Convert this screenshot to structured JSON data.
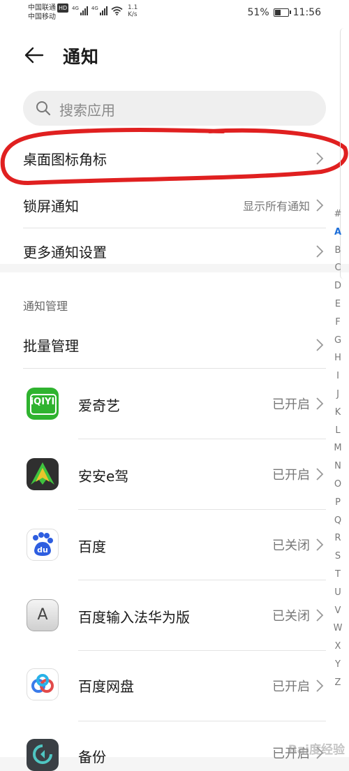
{
  "status_bar": {
    "carrier1": "中国联通",
    "carrier1_badge": "HD",
    "carrier2": "中国移动",
    "net1": "4G",
    "net2": "4G",
    "speed_value": "1.1",
    "speed_unit": "K/s",
    "battery": "51%",
    "battery_level": 0.51,
    "time": "11:56"
  },
  "header": {
    "title": "通知"
  },
  "search": {
    "placeholder": "搜索应用"
  },
  "settings": [
    {
      "label": "桌面图标角标",
      "value": ""
    },
    {
      "label": "锁屏通知",
      "value": "显示所有通知"
    },
    {
      "label": "更多通知设置",
      "value": ""
    }
  ],
  "section": {
    "title": "通知管理",
    "batch_label": "批量管理"
  },
  "apps": [
    {
      "name": "爱奇艺",
      "status": "已开启",
      "icon": "iqiyi-icon",
      "icon_text": "iQIYI"
    },
    {
      "name": "安安e驾",
      "status": "已开启",
      "icon": "anan-edrive-icon",
      "icon_text": ""
    },
    {
      "name": "百度",
      "status": "已关闭",
      "icon": "baidu-icon",
      "icon_text": "du"
    },
    {
      "name": "百度输入法华为版",
      "status": "已关闭",
      "icon": "baidu-input-icon",
      "icon_text": "A"
    },
    {
      "name": "百度网盘",
      "status": "已开启",
      "icon": "baidu-netdisk-icon",
      "icon_text": ""
    },
    {
      "name": "备份",
      "status": "已开启",
      "icon": "backup-icon",
      "icon_text": ""
    }
  ],
  "index_bar": [
    "#",
    "A",
    "B",
    "C",
    "D",
    "E",
    "F",
    "G",
    "H",
    "I",
    "J",
    "K",
    "L",
    "M",
    "N",
    "O",
    "P",
    "Q",
    "R",
    "S",
    "T",
    "U",
    "V",
    "W",
    "X",
    "Y",
    "Z"
  ],
  "index_active": "A",
  "watermark": "Bai度经验",
  "colors": {
    "accent": "#1e6fd9",
    "annotation": "#e02020",
    "iqiyi": "#2fb32f"
  }
}
